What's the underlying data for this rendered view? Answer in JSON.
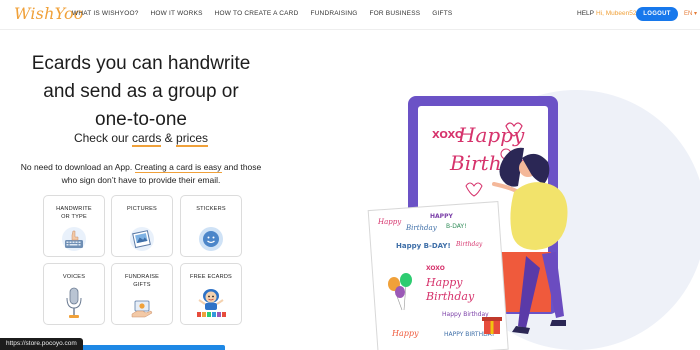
{
  "header": {
    "logo": "WishYoo",
    "nav": [
      "WHAT IS WISHYOO?",
      "HOW IT WORKS",
      "HOW TO CREATE A CARD",
      "FUNDRAISING",
      "FOR BUSINESS",
      "GIFTS"
    ],
    "help": "HELP",
    "greeting": "Hi, Mubeen525",
    "logout": "LOGOUT",
    "language": "EN"
  },
  "hero": {
    "title_line1": "Ecards you can handwrite",
    "title_line2": "and send as a group or",
    "title_line3": "one-to-one",
    "check_prefix": "Check our ",
    "check_cards": "cards",
    "check_and": " & ",
    "check_prices": "prices",
    "desc_part1": "No need to download an App. ",
    "desc_link": "Creating a card is easy",
    "desc_part2": " and those who sign don’t have to provide their email."
  },
  "features": [
    {
      "label": "HANDWRITE OR TYPE",
      "icon": "keyboard-hand-icon"
    },
    {
      "label": "PICTURES",
      "icon": "photo-icon"
    },
    {
      "label": "STICKERS",
      "icon": "sticker-icon"
    },
    {
      "label": "VOICES",
      "icon": "microphone-icon"
    },
    {
      "label": "FUNDRAISE GIFTS",
      "icon": "gift-money-icon"
    },
    {
      "label": "FREE ECARDS",
      "icon": "character-icon"
    }
  ],
  "illustration": {
    "tablet_text1": "XOXO",
    "tablet_text2": "Happy",
    "tablet_text3": "Birthday",
    "card_notes": [
      "XOXO",
      "Happy",
      "Birthday",
      "HAPPY",
      "B-DAY!",
      "Happy B-DAY!",
      "Happy Birthday",
      "HAPPY BIRTHDAY"
    ]
  },
  "status_bar": "https://store.pocoyo.com",
  "colors": {
    "accent": "#f0a13a",
    "primary": "#1778ec",
    "tablet": "#6b52c6"
  }
}
